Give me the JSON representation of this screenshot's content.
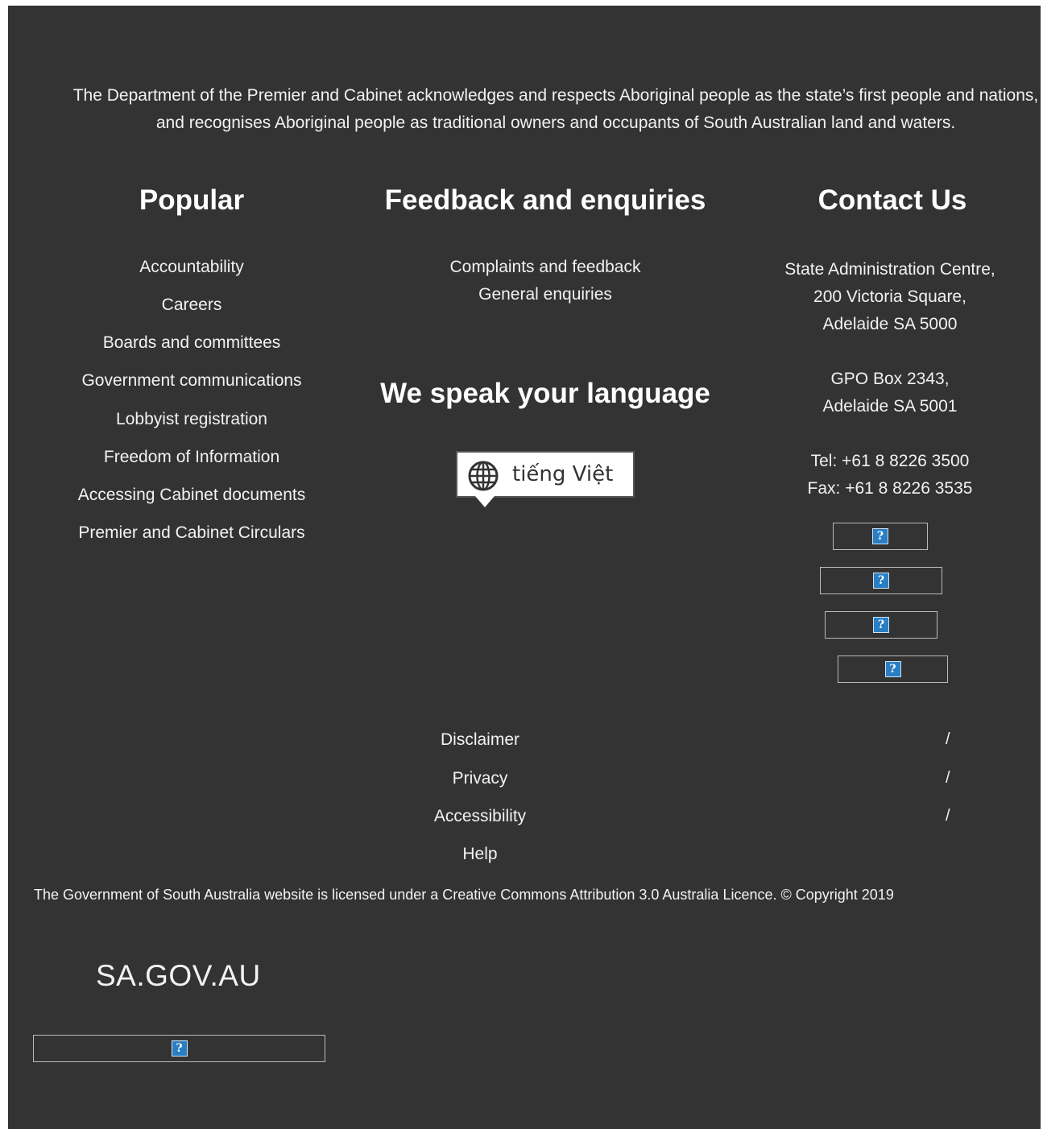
{
  "acknowledgement": "The Department of the Premier and Cabinet acknowledges and respects Aboriginal people as the state’s first people and nations, and recognises Aboriginal people as traditional owners and occupants of South Australian land and waters.",
  "popular": {
    "heading": "Popular",
    "links": [
      "Accountability",
      "Careers",
      "Boards and committees",
      "Government communications",
      "Lobbyist registration",
      "Freedom of Information",
      "Accessing Cabinet documents",
      "Premier and Cabinet Circulars"
    ]
  },
  "feedback": {
    "heading": "Feedback and enquiries",
    "links": [
      "Complaints and feedback",
      "General enquiries"
    ]
  },
  "language": {
    "heading": "We speak your language",
    "button_label": "tiếng Việt",
    "icon": "globe-icon"
  },
  "contact": {
    "heading": "Contact Us",
    "address_lines": [
      "State Administration Centre,",
      "200 Victoria Square,",
      "Adelaide SA 5000"
    ],
    "postal_lines": [
      "GPO Box 2343,",
      "Adelaide SA 5001"
    ],
    "tel": "Tel: +61 8 8226 3500",
    "fax": "Fax: +61 8 8226 3535",
    "social_icons": [
      "broken-image-icon",
      "broken-image-icon",
      "broken-image-icon",
      "broken-image-icon"
    ]
  },
  "legal": {
    "links": [
      "Disclaimer",
      "Privacy",
      "Accessibility",
      "Help"
    ],
    "separator": "/"
  },
  "licence": "The Government of South Australia website is licensed under a Creative Commons Attribution 3.0 Australia Licence. © Copyright 2019",
  "logo": "SA.GOV.AU",
  "colors": {
    "background": "#333333",
    "text": "#ffffff",
    "broken_icon": "#2a7fc4"
  }
}
